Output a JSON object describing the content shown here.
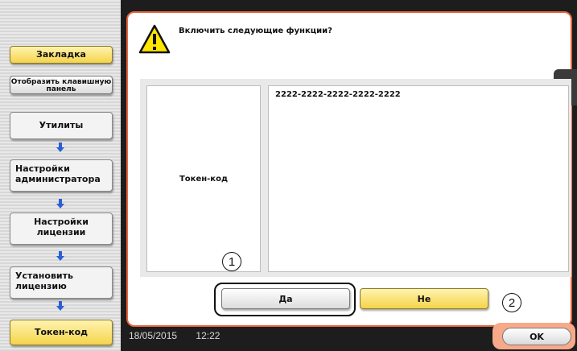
{
  "sidebar": {
    "bookmark_label": "Закладка",
    "keypad_label": "Отобразить клавишную панель",
    "nav": [
      {
        "label": "Утилиты"
      },
      {
        "label": "Настройки администратора"
      },
      {
        "label": "Настройки лицензии"
      },
      {
        "label": "Установить лицензию"
      },
      {
        "label": "Токен-код"
      }
    ]
  },
  "dialog": {
    "message": "Включить следующие функции?",
    "field_label": "Токен-код",
    "field_value": "2222-2222-2222-2222-2222",
    "yes_label": "Да",
    "no_label": "Не",
    "ok_label": "OK"
  },
  "markers": {
    "one": "1",
    "two": "2"
  },
  "status": {
    "date": "18/05/2015",
    "time": "12:22"
  },
  "colors": {
    "accent": "#e8643c",
    "yellow": "#f5d44a",
    "frame": "#1d1d1d"
  },
  "icons": {
    "warning": "warning-icon",
    "arrow": "arrow-down-icon",
    "tab": "double-chevron-left-icon"
  }
}
